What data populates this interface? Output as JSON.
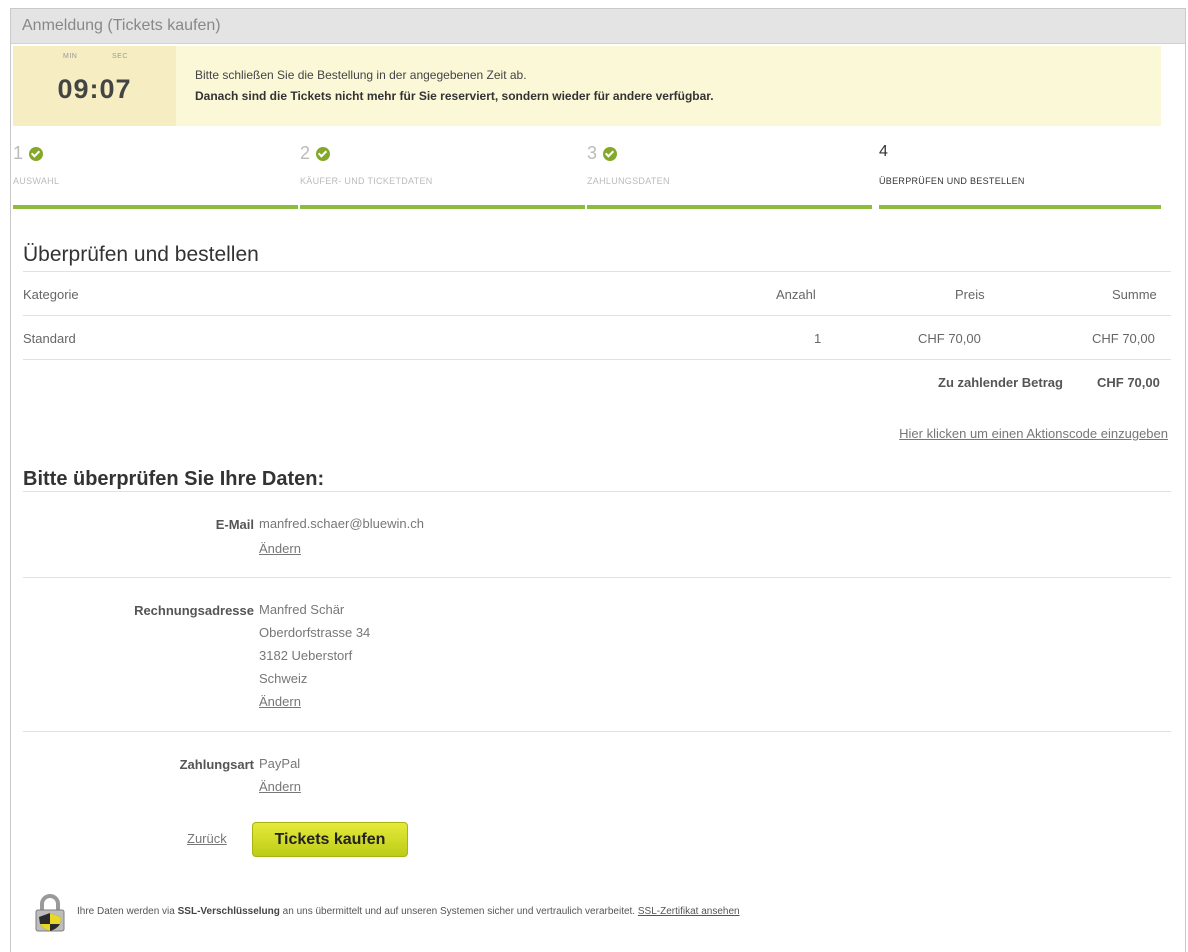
{
  "window": {
    "title": "Anmeldung (Tickets kaufen)"
  },
  "timer": {
    "min_label": "MIN",
    "sec_label": "SEC",
    "time": "09:07"
  },
  "notice": {
    "line1": "Bitte schließen Sie die Bestellung in der angegebenen Zeit ab.",
    "line2": "Danach sind die Tickets nicht mehr für Sie reserviert, sondern wieder für andere verfügbar."
  },
  "steps": [
    {
      "num": "1",
      "label": "AUSWAHL",
      "done": true
    },
    {
      "num": "2",
      "label": "KÄUFER- UND TICKETDATEN",
      "done": true
    },
    {
      "num": "3",
      "label": "ZAHLUNGSDATEN",
      "done": true
    },
    {
      "num": "4",
      "label": "ÜBERPRÜFEN UND BESTELLEN",
      "done": false
    }
  ],
  "review": {
    "title": "Überprüfen und bestellen",
    "columns": {
      "category": "Kategorie",
      "quantity": "Anzahl",
      "price": "Preis",
      "sum": "Summe"
    },
    "rows": [
      {
        "category": "Standard",
        "quantity": "1",
        "price": "CHF 70,00",
        "sum": "CHF 70,00"
      }
    ],
    "total_label": "Zu zahlender Betrag",
    "total_value": "CHF 70,00",
    "promo_link": "Hier klicken um einen Aktionscode einzugeben"
  },
  "data_check": {
    "title": "Bitte überprüfen Sie Ihre Daten:",
    "email_label": "E-Mail",
    "email_value": "manfred.schaer@bluewin.ch",
    "address_label": "Rechnungsadresse",
    "address_lines": [
      "Manfred Schär",
      "Oberdorfstrasse 34",
      "3182 Ueberstorf",
      "Schweiz"
    ],
    "payment_label": "Zahlungsart",
    "payment_value": "PayPal",
    "change_label": "Ändern"
  },
  "actions": {
    "back_label": "Zurück",
    "buy_label": "Tickets kaufen"
  },
  "ssl": {
    "prefix": "Ihre Daten werden via",
    "bold": "SSL-Verschlüsselung",
    "suffix": "an uns übermittelt und auf unseren Systemen sicher und vertraulich verarbeitet.",
    "link": "SSL-Zertifikat ansehen"
  },
  "colors": {
    "accent_green": "#8dbb3c",
    "check_green": "#84a829",
    "button_yellow": "#d4dc25",
    "notice_bg": "#fbf8d8"
  }
}
